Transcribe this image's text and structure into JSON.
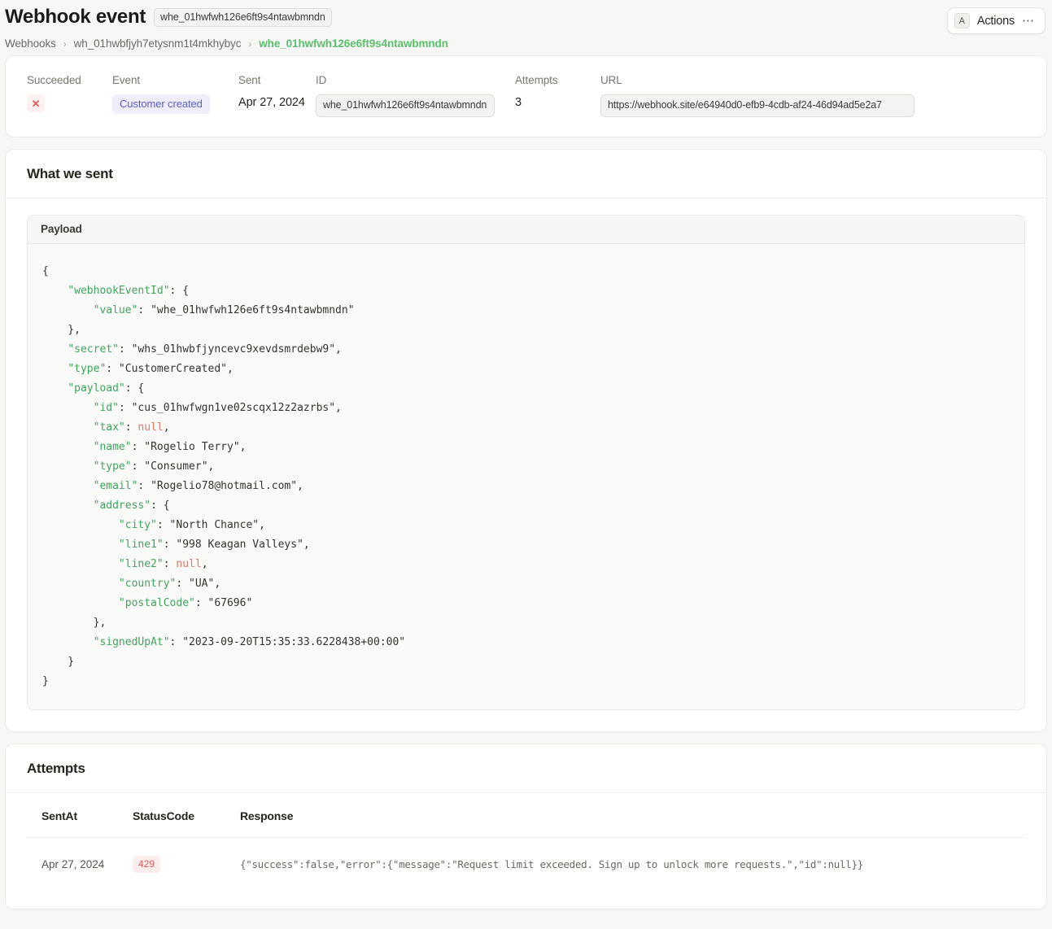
{
  "header": {
    "title": "Webhook event",
    "id_chip": "whe_01hwfwh126e6ft9s4ntawbmndn",
    "breadcrumb": [
      {
        "label": "Webhooks",
        "active": false
      },
      {
        "label": "wh_01hwbfjyh7etysnm1t4mkhybyc",
        "active": false
      },
      {
        "label": "whe_01hwfwh126e6ft9s4ntawbmndn",
        "active": true
      }
    ],
    "separator": "›",
    "actions": {
      "kbd": "A",
      "label": "Actions",
      "dots": "…"
    }
  },
  "summary": {
    "succeeded": {
      "label": "Succeeded",
      "icon": "x-mark-icon",
      "value": "✕"
    },
    "event": {
      "label": "Event",
      "value": "Customer created"
    },
    "sent": {
      "label": "Sent",
      "value": "Apr 27, 2024"
    },
    "id": {
      "label": "ID",
      "value": "whe_01hwfwh126e6ft9s4ntawbmndn"
    },
    "attempts": {
      "label": "Attempts",
      "value": "3"
    },
    "url": {
      "label": "URL",
      "value": "https://webhook.site/e64940d0-efb9-4cdb-af24-46d94ad5e2a7"
    }
  },
  "what_we_sent": {
    "heading": "What we sent",
    "payload_label": "Payload",
    "payload_json": "{\n    \"webhookEventId\": {\n        \"value\": \"whe_01hwfwh126e6ft9s4ntawbmndn\"\n    },\n    \"secret\": \"whs_01hwbfjyncevc9xevdsmrdebw9\",\n    \"type\": \"CustomerCreated\",\n    \"payload\": {\n        \"id\": \"cus_01hwfwgn1ve02scqx12z2azrbs\",\n        \"tax\": null,\n        \"name\": \"Rogelio Terry\",\n        \"type\": \"Consumer\",\n        \"email\": \"Rogelio78@hotmail.com\",\n        \"address\": {\n            \"city\": \"North Chance\",\n            \"line1\": \"998 Keagan Valleys\",\n            \"line2\": null,\n            \"country\": \"UA\",\n            \"postalCode\": \"67696\"\n        },\n        \"signedUpAt\": \"2023-09-20T15:35:33.6228438+00:00\"\n    }\n}"
  },
  "attempts_section": {
    "heading": "Attempts",
    "columns": [
      "SentAt",
      "StatusCode",
      "Response"
    ],
    "rows": [
      {
        "sent_at": "Apr 27, 2024",
        "status_code": "429",
        "response": "{\"success\":false,\"error\":{\"message\":\"Request limit exceeded. Sign up to unlock more requests.\",\"id\":null}}"
      }
    ]
  },
  "colors": {
    "page_bg": "#f7f7f6",
    "accent_green": "#5bbf6a",
    "badge_indigo_text": "#5b5bd6",
    "badge_indigo_bg": "#eeeefc",
    "error_red": "#dd5b5b",
    "error_bg": "#fdeeee",
    "json_key_green": "#3fa55b",
    "json_string_green": "#5ec07a",
    "json_null_red": "#e2776b"
  }
}
